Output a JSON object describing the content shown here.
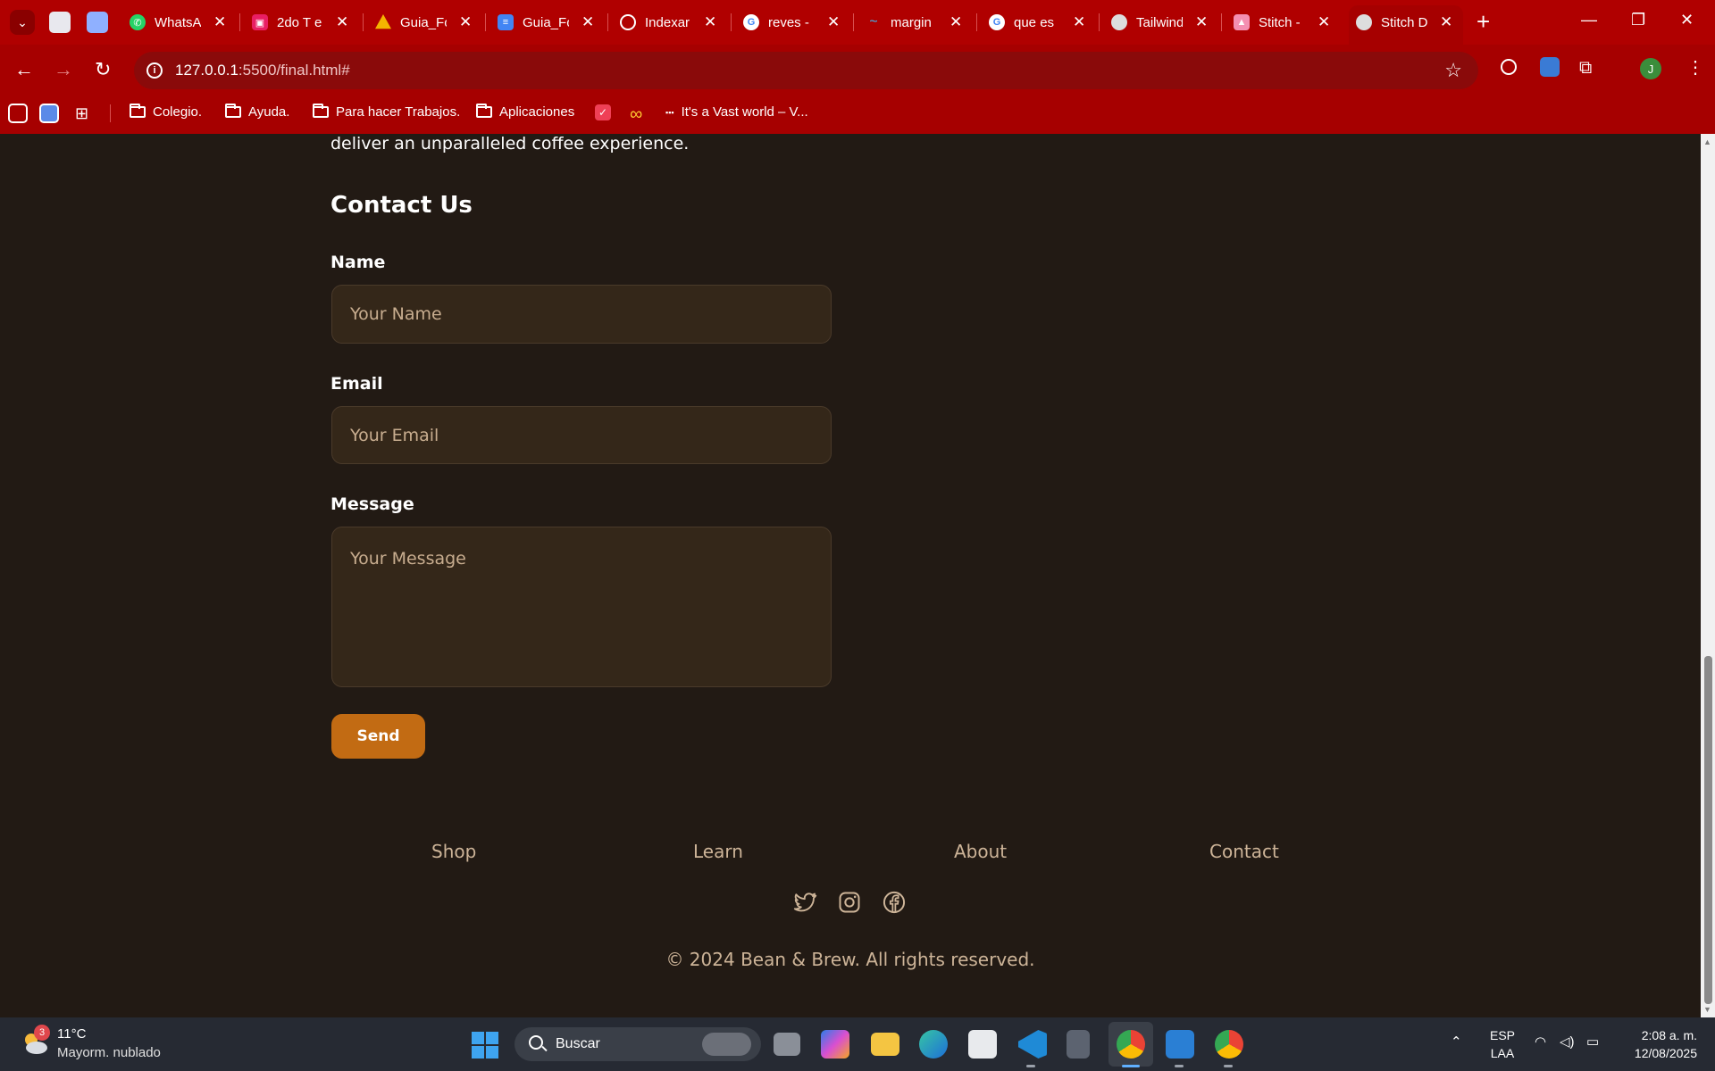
{
  "browser": {
    "tabs": [
      {
        "title": "WhatsApp",
        "icon": "whatsapp-icon",
        "color": "#25d366"
      },
      {
        "title": "2do T e",
        "icon": "classroom-icon",
        "color": "#e91e63"
      },
      {
        "title": "Guia_Fo",
        "icon": "drive-icon",
        "color": "#f4b400"
      },
      {
        "title": "Guia_Fo",
        "icon": "docs-icon",
        "color": "#4285f4"
      },
      {
        "title": "Indexar",
        "icon": "openai-icon",
        "color": "#ffffff"
      },
      {
        "title": "reves -",
        "icon": "google-icon",
        "color": "#ffffff"
      },
      {
        "title": "margin",
        "icon": "tailwind-icon",
        "color": "#38bdf8"
      },
      {
        "title": "que es",
        "icon": "google-icon",
        "color": "#ffffff"
      },
      {
        "title": "Tailwind",
        "icon": "globe-icon",
        "color": "#dddddd"
      },
      {
        "title": "Stitch -",
        "icon": "stitch-icon",
        "color": "#f48fb1"
      },
      {
        "title": "Stitch D",
        "icon": "globe-icon",
        "color": "#dddddd",
        "active": true
      }
    ],
    "url_host": "127.0.0.1",
    "url_path": ":5500/final.html#",
    "profile_initial": "J",
    "bookmarks": [
      {
        "label": "Colegio.",
        "icon": "folder-icon"
      },
      {
        "label": "Ayuda.",
        "icon": "folder-icon"
      },
      {
        "label": "Para hacer Trabajos.",
        "icon": "folder-icon"
      },
      {
        "label": "Aplicaciones",
        "icon": "folder-icon"
      },
      {
        "label": "",
        "icon": "pocket-icon"
      },
      {
        "label": "",
        "icon": "infinity-icon"
      },
      {
        "label": "It's a Vast world – V...",
        "icon": "vast-icon"
      }
    ]
  },
  "page": {
    "intro_tail": "deliver an unparalleled coffee experience.",
    "contact_title": "Contact Us",
    "form": {
      "name_label": "Name",
      "name_placeholder": "Your Name",
      "email_label": "Email",
      "email_placeholder": "Your Email",
      "message_label": "Message",
      "message_placeholder": "Your Message",
      "send_label": "Send"
    },
    "footer": {
      "links": [
        "Shop",
        "Learn",
        "About",
        "Contact"
      ],
      "social_icons": [
        "twitter-icon",
        "instagram-icon",
        "facebook-icon"
      ],
      "copyright": "© 2024 Bean & Brew. All rights reserved."
    },
    "colors": {
      "background": "#221a14",
      "field_bg": "#342719",
      "accent": "#c26b13",
      "muted_text": "#cdb498"
    }
  },
  "taskbar": {
    "weather_temp": "11°C",
    "weather_desc": "Mayorm. nublado",
    "weather_badge": "3",
    "search_placeholder": "Buscar",
    "lang_top": "ESP",
    "lang_bottom": "LAA",
    "time": "2:08 a. m.",
    "date": "12/08/2025",
    "apps": [
      "task-view-icon",
      "copilot-icon",
      "file-explorer-icon",
      "edge-icon",
      "store-icon",
      "vscode-icon",
      "calculator-icon",
      "chrome-icon",
      "photos-icon",
      "chrome-profile-icon"
    ]
  }
}
